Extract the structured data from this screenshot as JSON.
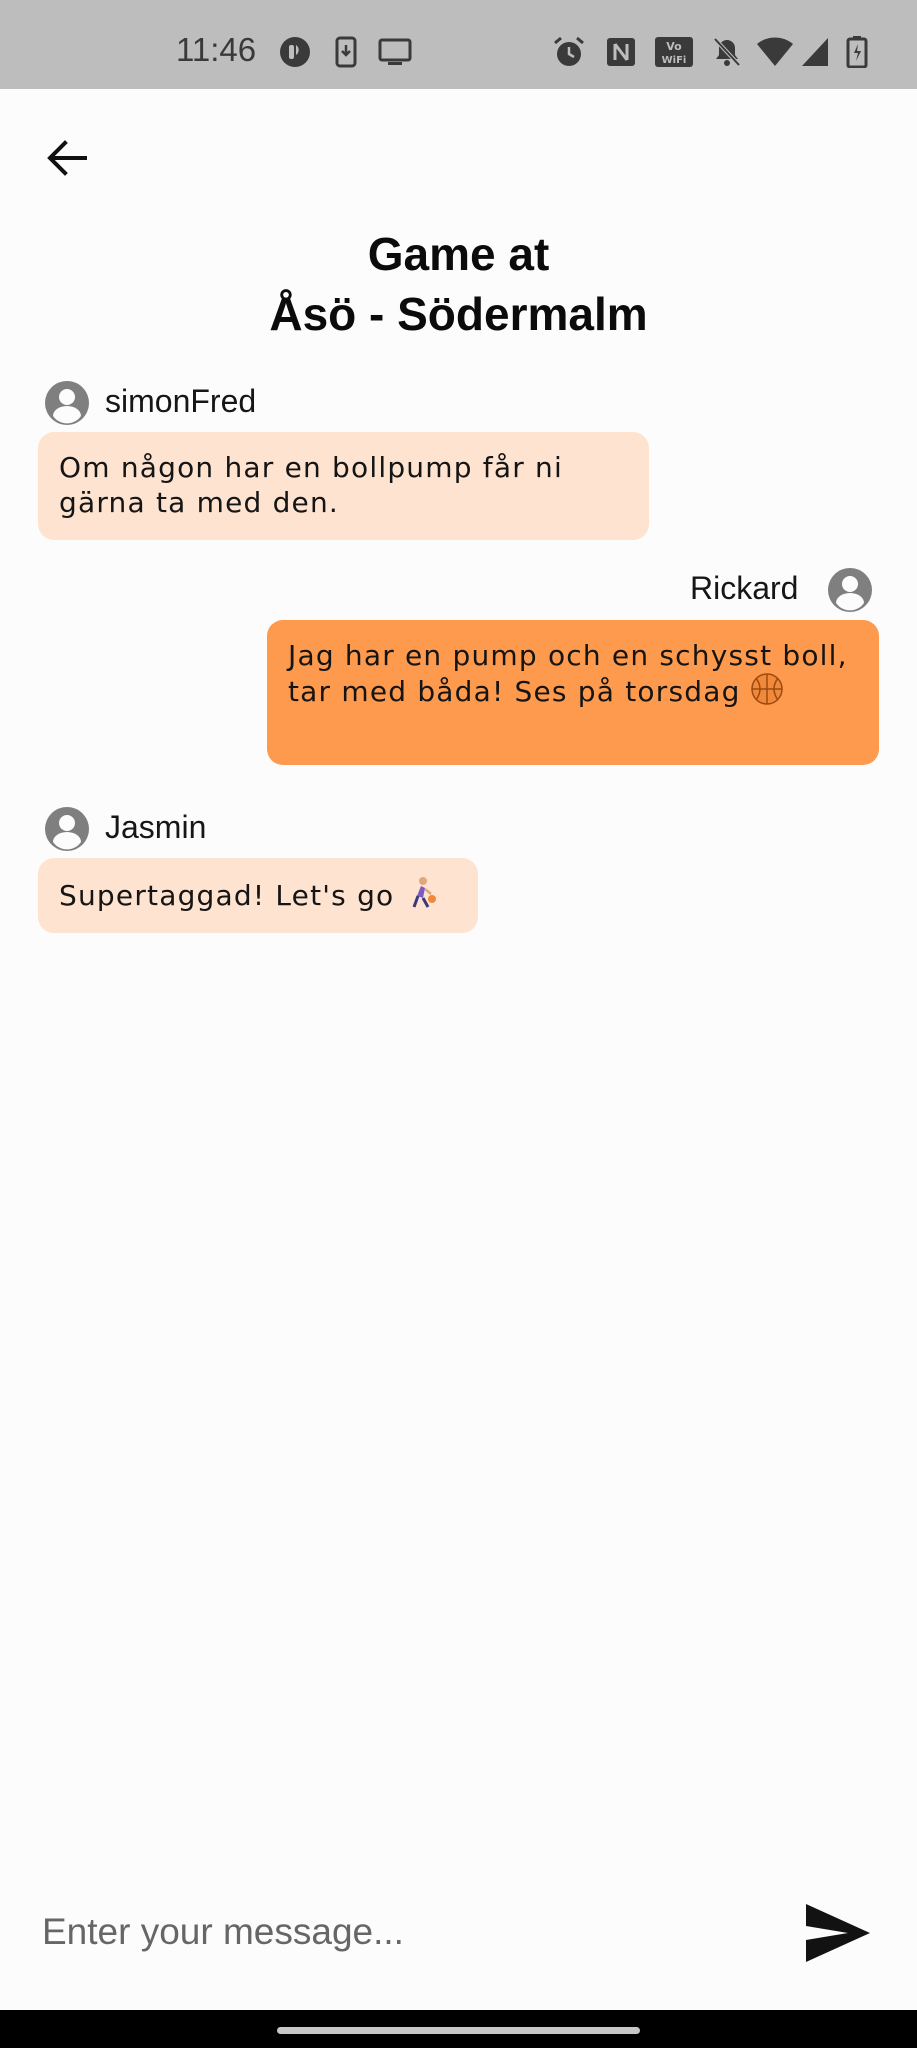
{
  "status_bar": {
    "time": "11:46",
    "left_icons": [
      "messenger-icon",
      "download-icon",
      "cast-icon"
    ],
    "right_icons": [
      "alarm-icon",
      "nfc-icon",
      "vowifi-icon",
      "mute-icon",
      "wifi-icon",
      "signal-icon",
      "battery-icon"
    ]
  },
  "header": {
    "back_icon": "arrow-left-icon",
    "title_line1": "Game at",
    "title_line2": "Åsö - Södermalm"
  },
  "messages": [
    {
      "sender": "simonFred",
      "side": "left",
      "text": "Om någon har en bollpump får ni gärna ta med den.",
      "emoji": ""
    },
    {
      "sender": "Rickard",
      "side": "right",
      "text": "Jag har en pump och en schysst boll, tar med båda! Ses på torsdag",
      "emoji": "🏀"
    },
    {
      "sender": "Jasmin",
      "side": "left",
      "text": "Supertaggad! Let's go",
      "emoji": "⛹🏼‍♀️"
    }
  ],
  "composer": {
    "placeholder": "Enter your message...",
    "value": "",
    "send_icon": "send-icon"
  },
  "colors": {
    "status_bar_bg": "#bdbdbd",
    "page_bg": "#fdfcfc",
    "bubble_other": "#fee3d1",
    "bubble_mine": "#fe9a4d",
    "avatar_gray": "#7f7f7f"
  }
}
